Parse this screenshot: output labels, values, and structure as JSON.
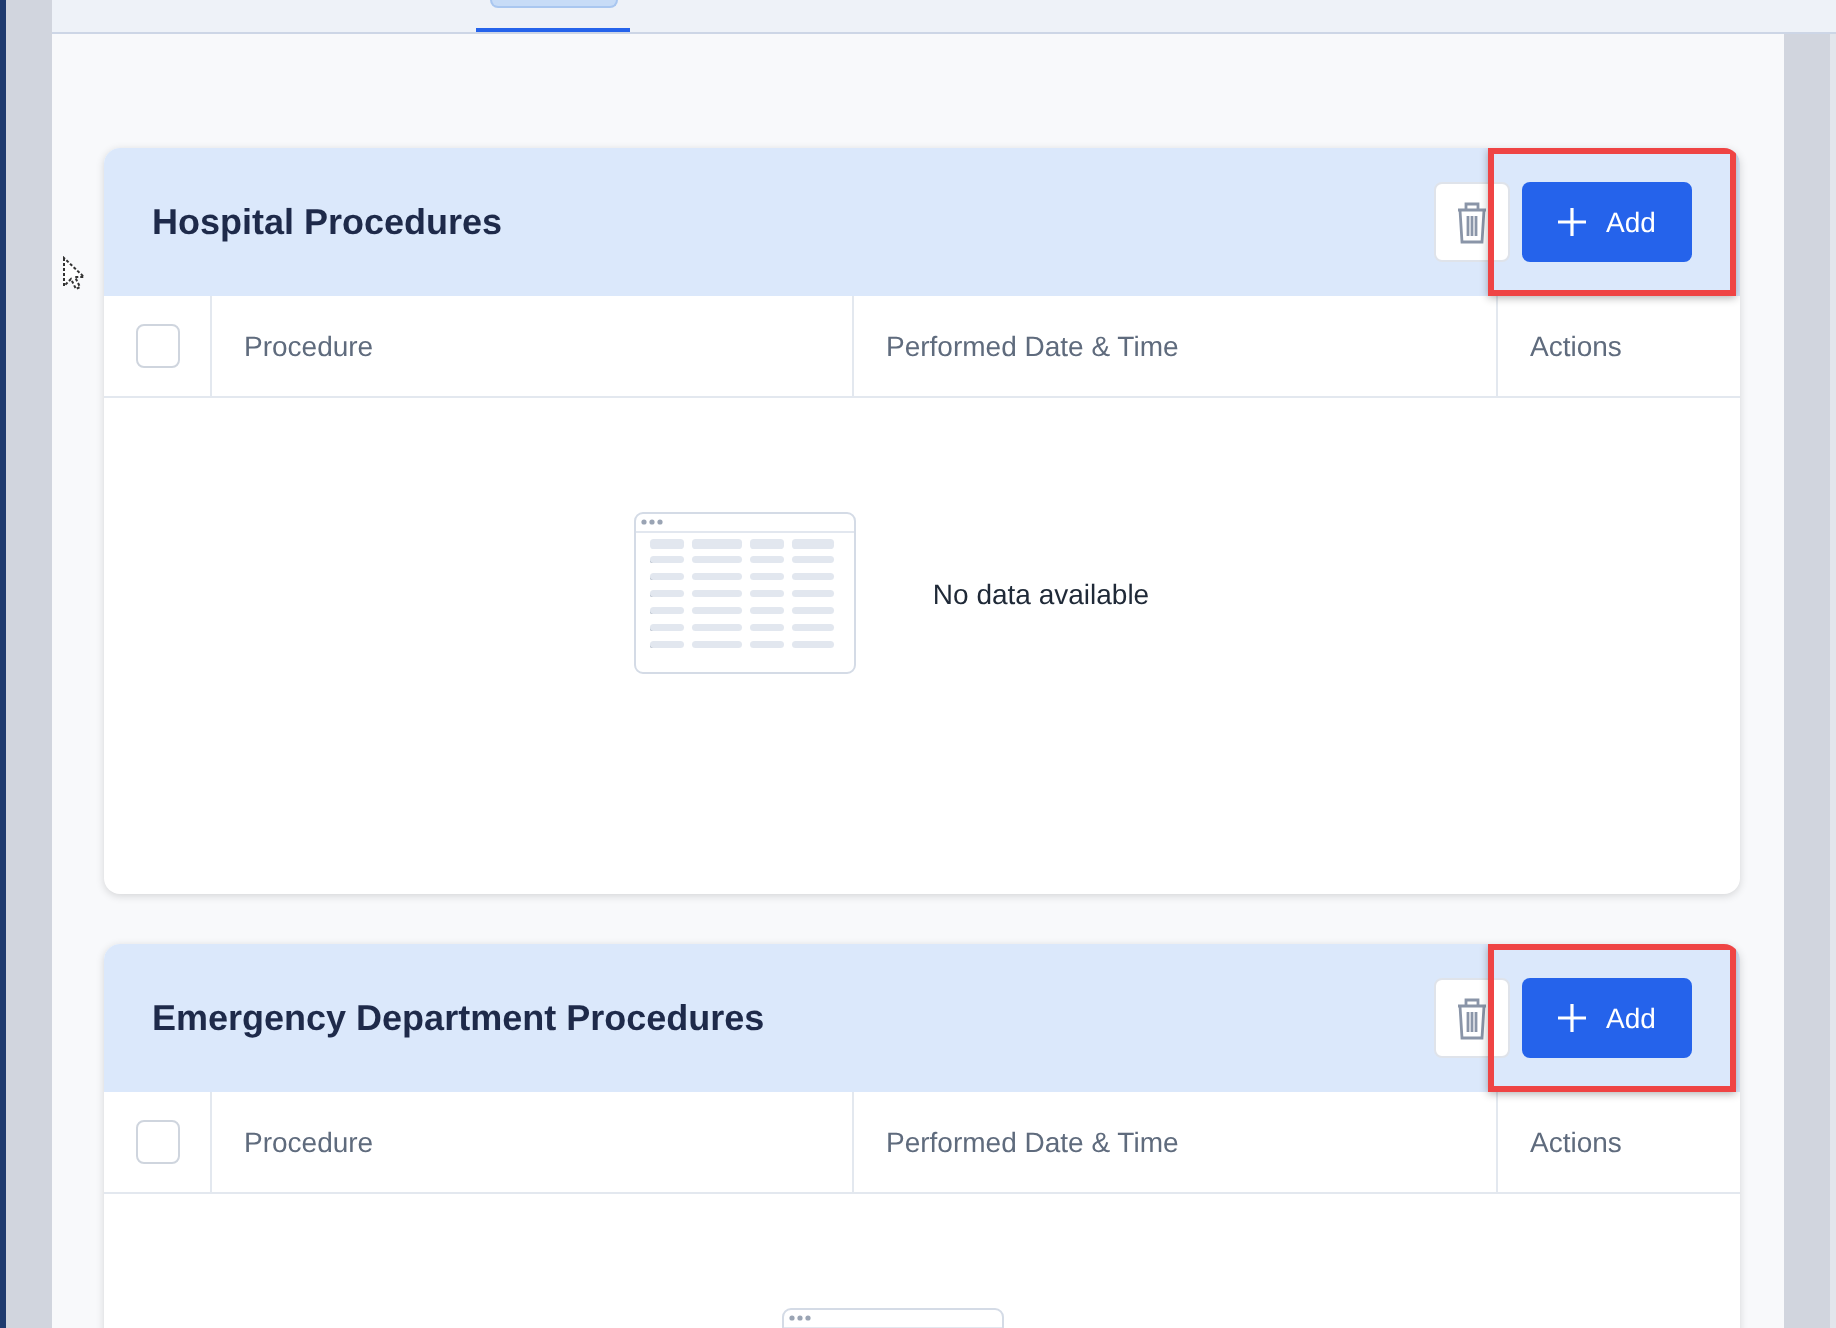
{
  "sections": [
    {
      "title": "Hospital Procedures",
      "select_all": {
        "checked": false
      },
      "columns": [
        "Procedure",
        "Performed Date & Time",
        "Actions"
      ],
      "add_button": {
        "label": "Add",
        "highlighted": true
      },
      "empty_message": "No data available"
    },
    {
      "title": "Emergency Department Procedures",
      "select_all": {
        "checked": false
      },
      "columns": [
        "Procedure",
        "Performed Date & Time",
        "Actions"
      ],
      "add_button": {
        "label": "Add",
        "highlighted": true
      }
    }
  ]
}
